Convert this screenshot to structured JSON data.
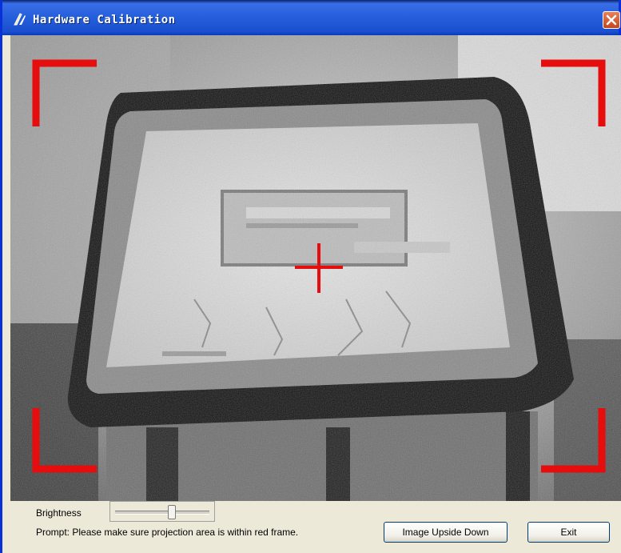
{
  "window": {
    "title": "Hardware Calibration"
  },
  "icons": {
    "app": "calibration-icon",
    "close": "close-icon"
  },
  "colors": {
    "frame_marker": "#e50d0d",
    "title_bar": "#245edb"
  },
  "controls": {
    "brightness_label": "Brightness",
    "brightness_level": 0.6,
    "prompt": "Prompt: Please make sure projection area is within red frame.",
    "flip_button": "Image Upside Down",
    "exit_button": "Exit"
  }
}
